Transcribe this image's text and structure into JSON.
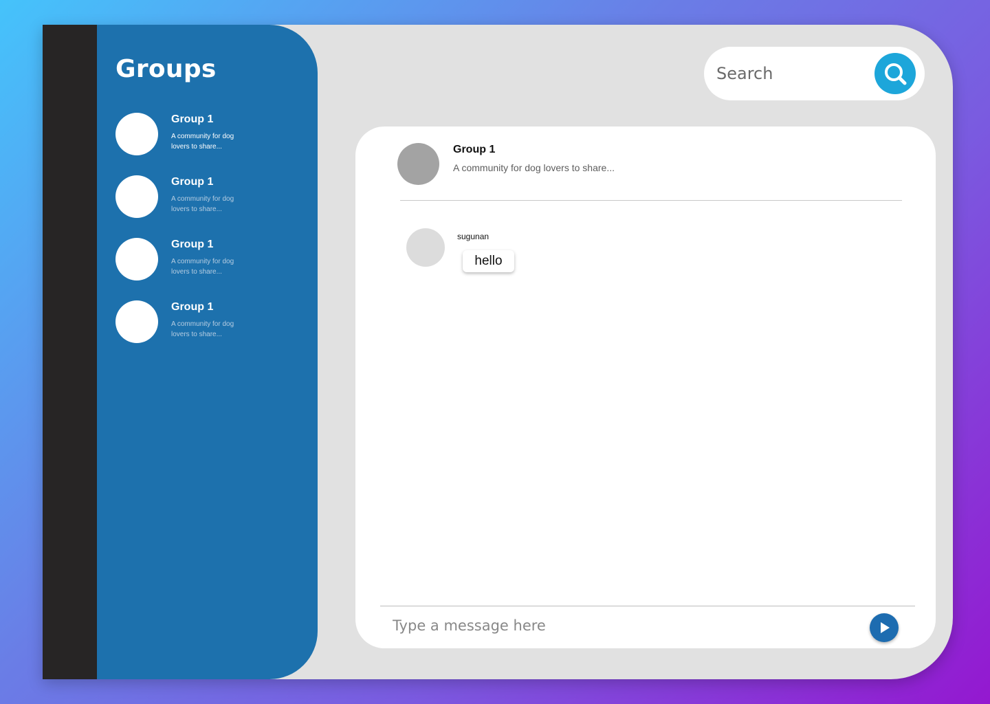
{
  "sidebar": {
    "title": "Groups",
    "groups": [
      {
        "name": "Group 1",
        "description": "A community for dog lovers to share..."
      },
      {
        "name": "Group 1",
        "description": "A community for dog lovers to share..."
      },
      {
        "name": "Group 1",
        "description": "A community for dog lovers to share..."
      },
      {
        "name": "Group 1",
        "description": "A community for dog lovers to share..."
      }
    ]
  },
  "search": {
    "placeholder": "Search",
    "icon": "search-icon"
  },
  "chat": {
    "title": "Group 1",
    "subtitle": "A community for dog lovers to share...",
    "messages": [
      {
        "author": "sugunan",
        "text": "hello"
      }
    ],
    "input_placeholder": "Type a message here",
    "send_icon": "send-icon"
  },
  "colors": {
    "sidebar": "#1d71ad",
    "rail": "#272525",
    "search_button": "#1da6da",
    "send_button": "#1d6cb0"
  }
}
